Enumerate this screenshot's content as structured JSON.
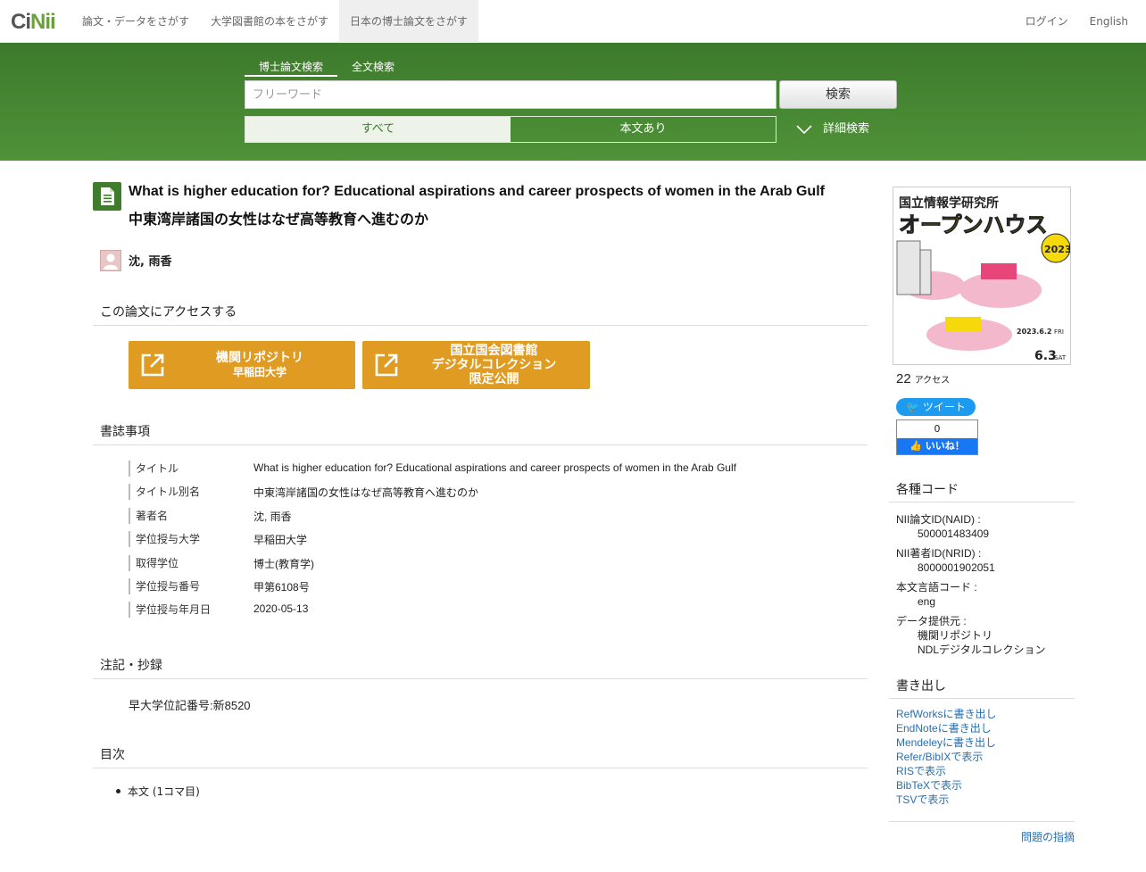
{
  "nav": {
    "logo_prefix": "Ci",
    "logo_suffix": "Nii",
    "links": [
      {
        "label": "論文・データをさがす"
      },
      {
        "label": "大学図書館の本をさがす"
      },
      {
        "label": "日本の博士論文をさがす"
      }
    ],
    "login": "ログイン",
    "english": "English"
  },
  "search": {
    "tabs": [
      {
        "label": "博士論文検索"
      },
      {
        "label": "全文検索"
      }
    ],
    "placeholder": "フリーワード",
    "button": "検索",
    "filters": [
      {
        "label": "すべて"
      },
      {
        "label": "本文あり"
      }
    ],
    "advanced": "詳細検索"
  },
  "thesis": {
    "title": "What is higher education for? Educational aspirations and career prospects of women in the Arab Gulf",
    "title_alt": "中東湾岸諸国の女性はなぜ高等教育へ進むのか",
    "author": "沈, 雨香"
  },
  "access_section": {
    "heading": "この論文にアクセスする",
    "buttons": [
      {
        "line1": "機関リポジトリ",
        "line2": "早稲田大学",
        "line3": ""
      },
      {
        "line1": "国立国会図書館",
        "line2": "デジタルコレクション",
        "line3": "限定公開"
      }
    ]
  },
  "biblio": {
    "heading": "書誌事項",
    "rows": [
      {
        "key": "タイトル",
        "value": "What is higher education for? Educational aspirations and career prospects of women in the Arab Gulf"
      },
      {
        "key": "タイトル別名",
        "value": "中東湾岸諸国の女性はなぜ高等教育へ進むのか"
      },
      {
        "key": "著者名",
        "value": "沈, 雨香"
      },
      {
        "key": "学位授与大学",
        "value": "早稲田大学"
      },
      {
        "key": "取得学位",
        "value": "博士(教育学)"
      },
      {
        "key": "学位授与番号",
        "value": "甲第6108号"
      },
      {
        "key": "学位授与年月日",
        "value": "2020-05-13"
      }
    ]
  },
  "notes": {
    "heading": "注記・抄録",
    "text": "早大学位記番号:新8520"
  },
  "toc": {
    "heading": "目次",
    "items": [
      {
        "label": "本文 (1コマ目)"
      }
    ]
  },
  "sidebar": {
    "banner": {
      "org": "国立情報学研究所",
      "title": "オープンハウス",
      "year": "2023",
      "date1": "2023.6.2",
      "day1": "FRI",
      "date2": "6.3",
      "day2": "SAT"
    },
    "access_count": "22",
    "access_unit": "アクセス",
    "tweet": "ツイート",
    "like_count": "0",
    "like": "いいね！",
    "codes_heading": "各種コード",
    "codes": [
      {
        "key": "NII論文ID(NAID) :",
        "values": [
          "500001483409"
        ]
      },
      {
        "key": "NII著者ID(NRID) :",
        "values": [
          "8000001902051"
        ]
      },
      {
        "key": "本文言語コード :",
        "values": [
          "eng"
        ]
      },
      {
        "key": "データ提供元 :",
        "values": [
          "機関リポジトリ",
          "NDLデジタルコレクション"
        ]
      }
    ],
    "export_heading": "書き出し",
    "exports": [
      {
        "label": "RefWorksに書き出し"
      },
      {
        "label": "EndNoteに書き出し"
      },
      {
        "label": "Mendeleyに書き出し"
      },
      {
        "label": "Refer/BibIXで表示"
      },
      {
        "label": "RISで表示"
      },
      {
        "label": "BibTeXで表示"
      },
      {
        "label": "TSVで表示"
      }
    ],
    "report": "問題の指摘"
  },
  "colors": {
    "green": "#3f7d2d",
    "orange": "#e09b22",
    "link": "#2a6fb0"
  }
}
